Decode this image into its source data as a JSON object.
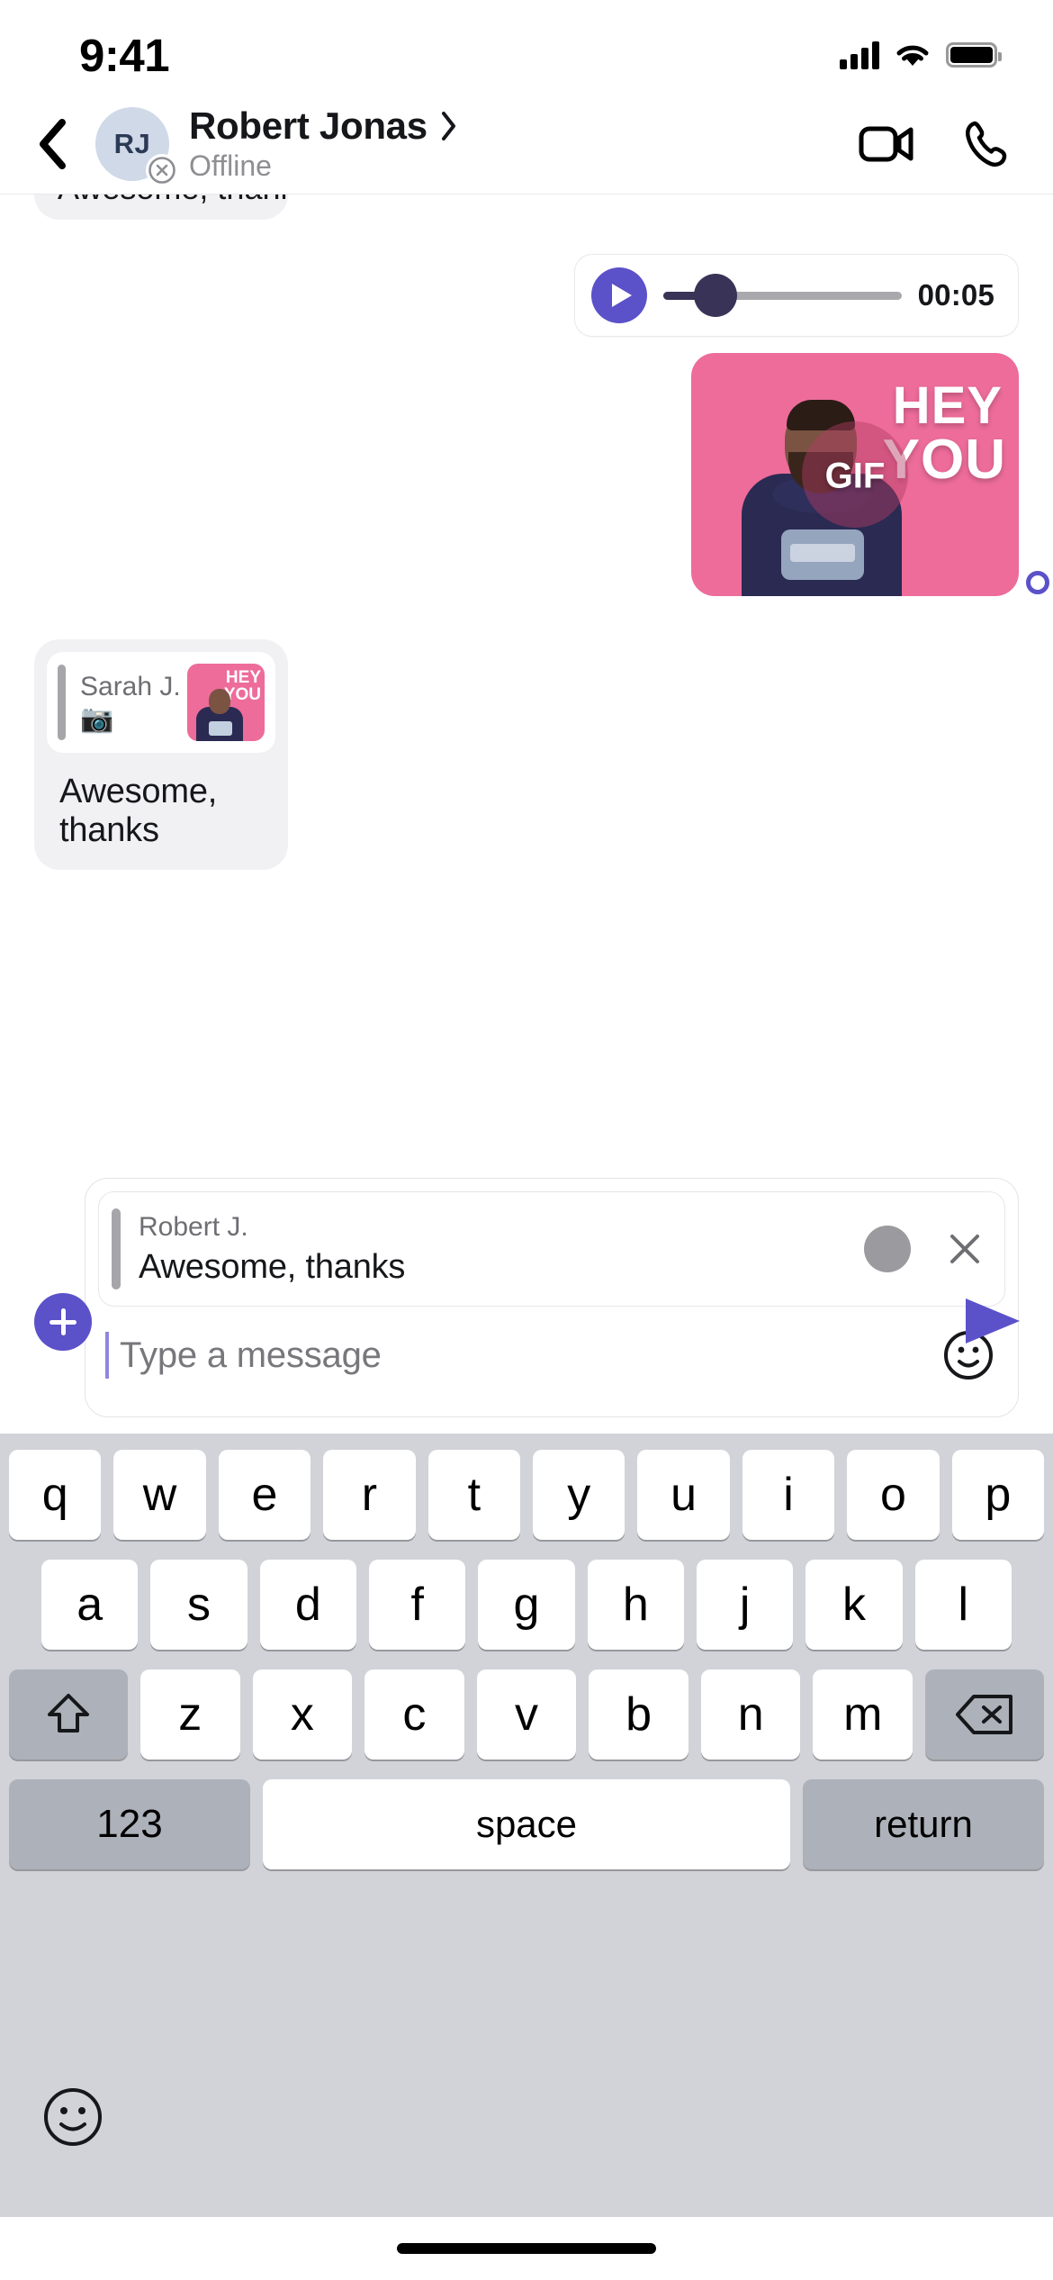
{
  "status_bar": {
    "time": "9:41",
    "cellular_icon": "cellular-signal-icon",
    "wifi_icon": "wifi-icon",
    "battery_icon": "battery-icon"
  },
  "nav_bar": {
    "back_icon": "chevron-left-icon",
    "avatar_initials": "RJ",
    "presence_icon": "offline-badge-icon",
    "contact_name": "Robert Jonas",
    "disclosure_icon": "chevron-right-icon",
    "status": "Offline",
    "video_call_icon": "video-camera-icon",
    "voice_call_icon": "phone-icon"
  },
  "conversation": {
    "clipped_message": {
      "text": "Awesome, thanks"
    },
    "audio_message": {
      "play_icon": "play-icon",
      "duration": "00:05",
      "progress_percent": 13
    },
    "gif_message": {
      "badge": "GIF",
      "line1": "HEY",
      "line2": "YOU",
      "background_color": "#ED6C9A",
      "read_receipt_icon": "read-receipt-icon"
    },
    "quoted_message": {
      "author": "Sarah J.",
      "attachment_icon": "📷",
      "thumb_line1": "HEY",
      "thumb_line2": "YOU",
      "body": "Awesome, thanks"
    }
  },
  "composer": {
    "reply_preview": {
      "author": "Robert J.",
      "text": "Awesome, thanks",
      "thumb_icon": "attachment-thumbnail",
      "close_icon": "close-icon"
    },
    "input_placeholder": "Type a message",
    "emoji_icon": "emoji-smiley-icon",
    "add_icon": "plus-icon",
    "send_icon": "send-paper-plane-icon"
  },
  "keyboard": {
    "row1": [
      "q",
      "w",
      "e",
      "r",
      "t",
      "y",
      "u",
      "i",
      "o",
      "p"
    ],
    "row2": [
      "a",
      "s",
      "d",
      "f",
      "g",
      "h",
      "j",
      "k",
      "l"
    ],
    "row3": [
      "z",
      "x",
      "c",
      "v",
      "b",
      "n",
      "m"
    ],
    "shift_icon": "shift-up-arrow-icon",
    "backspace_icon": "backspace-delete-icon",
    "numbers_key": "123",
    "space_key": "space",
    "return_key": "return",
    "emoji_key_icon": "keyboard-emoji-icon"
  },
  "colors": {
    "accent_purple": "#5B51C9",
    "audio_track_dark": "#393358",
    "gif_pink": "#ED6C9A",
    "keyboard_bg": "#D1D3D9",
    "bubble_gray": "#F1F1F3"
  }
}
